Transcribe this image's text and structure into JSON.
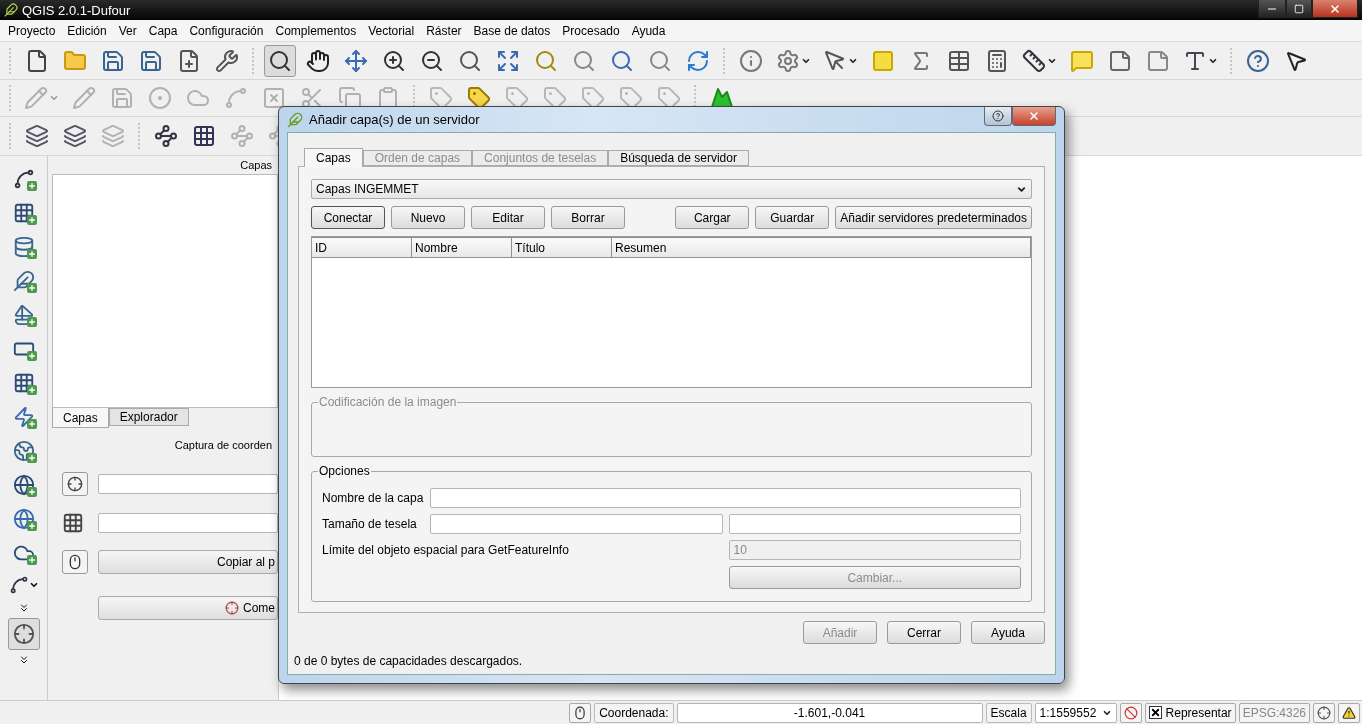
{
  "window": {
    "title": "QGIS 2.0.1-Dufour"
  },
  "menu": [
    "Proyecto",
    "Edición",
    "Ver",
    "Capa",
    "Configuración",
    "Complementos",
    "Vectorial",
    "Ráster",
    "Base de datos",
    "Procesado",
    "Ayuda"
  ],
  "toolbars": [
    {
      "buttons": [
        {
          "selected": false
        },
        {
          "selected": false
        },
        {
          "selected": false
        },
        {
          "selected": false
        },
        {
          "selected": false
        },
        {
          "selected": false
        },
        {
          "selected": true
        },
        {
          "selected": false
        },
        {
          "selected": false
        },
        {
          "selected": false
        },
        {
          "selected": false
        },
        {
          "selected": false
        },
        {
          "selected": false
        },
        {
          "selected": false
        },
        {
          "selected": false
        },
        {
          "selected": false
        },
        {
          "selected": false
        },
        {
          "selected": false
        },
        {
          "selected": false
        },
        {
          "selected": false
        },
        {
          "selected": false
        },
        {
          "selected": false
        },
        {
          "selected": false
        },
        {
          "selected": false
        },
        {
          "selected": false
        },
        {
          "selected": false
        },
        {
          "selected": false
        },
        {
          "selected": false
        },
        {
          "selected": false
        },
        {
          "selected": false
        },
        {
          "selected": false
        },
        {
          "selected": false
        }
      ]
    },
    {
      "buttons": [
        {
          "disabled": true
        },
        {
          "disabled": true
        },
        {
          "disabled": true
        },
        {
          "disabled": true
        },
        {
          "disabled": true
        },
        {
          "disabled": true
        },
        {
          "disabled": true
        },
        {
          "disabled": true
        },
        {
          "disabled": true
        },
        {
          "disabled": true
        },
        {
          "disabled": true
        },
        {
          "disabled": false
        },
        {
          "disabled": true
        },
        {
          "disabled": true
        },
        {
          "disabled": true
        },
        {
          "disabled": true
        },
        {
          "disabled": true
        },
        {
          "disabled": false
        }
      ]
    },
    {
      "buttons": [
        {
          "disabled": false
        },
        {
          "disabled": false
        },
        {
          "disabled": true
        },
        {
          "disabled": false
        },
        {
          "disabled": false
        },
        {
          "disabled": true
        },
        {
          "disabled": true
        }
      ]
    }
  ],
  "left_toolbar": {
    "capture_selected": true
  },
  "layers_dock": {
    "title": "Capas",
    "tabs": [
      {
        "label": "Capas",
        "selected": true
      },
      {
        "label": "Explorador",
        "selected": false
      }
    ]
  },
  "coordinate_dock": {
    "title": "Captura de coorden",
    "copy_button": "Copiar al p",
    "start_button": "Come"
  },
  "dialog": {
    "title": "Añadir capa(s) de un servidor",
    "tabs": [
      {
        "label": "Capas",
        "selected": true,
        "disabled": false
      },
      {
        "label": "Orden de capas",
        "selected": false,
        "disabled": true
      },
      {
        "label": "Conjuntos de teselas",
        "selected": false,
        "disabled": true
      },
      {
        "label": "Búsqueda de servidor",
        "selected": false,
        "disabled": false
      }
    ],
    "connection": "Capas INGEMMET",
    "connection_buttons": [
      "Conectar",
      "Nuevo",
      "Editar",
      "Borrar"
    ],
    "file_buttons": [
      "Cargar",
      "Guardar",
      "Añadir servidores predeterminados"
    ],
    "table": {
      "columns": [
        "ID",
        "Nombre",
        "Título",
        "Resumen"
      ]
    },
    "encoding": {
      "title": "Codificación de la imagen",
      "disabled": true
    },
    "options": {
      "title": "Opciones",
      "layer_name_label": "Nombre de la capa",
      "tile_size_label": "Tamaño de tesela",
      "feature_limit_label": "Límite del objeto espacial para GetFeatureInfo",
      "feature_limit": {
        "value": "10",
        "disabled": true
      },
      "change_button": {
        "label": "Cambiar...",
        "disabled": true
      }
    },
    "footer_buttons": [
      {
        "label": "Añadir",
        "disabled": true
      },
      {
        "label": "Cerrar",
        "disabled": false
      },
      {
        "label": "Ayuda",
        "disabled": false
      }
    ],
    "status": "0 de 0 bytes de capacidades descargados."
  },
  "status_bar": {
    "coordinate_label": "Coordenada:",
    "coordinate": "-1.601,-0.041",
    "scale_label": "Escala",
    "scale": "1:1559552",
    "render": {
      "label": "Representar",
      "checked": true
    },
    "crs": "EPSG:4326"
  }
}
